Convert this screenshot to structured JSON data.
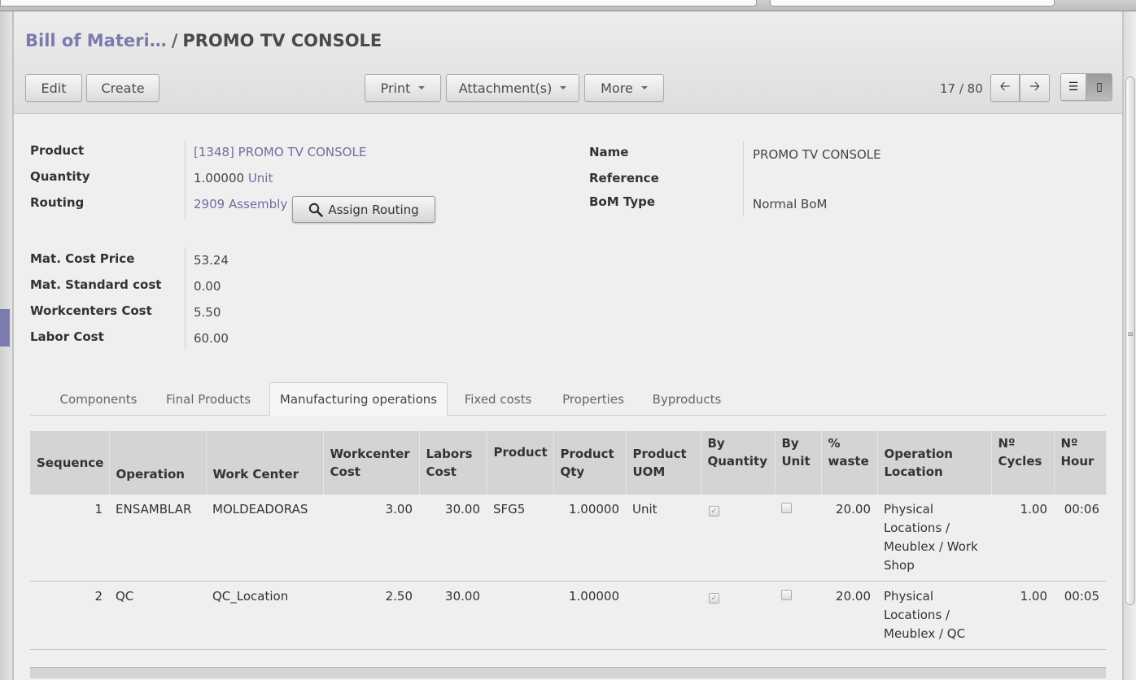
{
  "breadcrumb": {
    "parent": "Bill of Materi…",
    "separator": "/",
    "current": "PROMO TV CONSOLE"
  },
  "toolbar": {
    "edit": "Edit",
    "create": "Create",
    "print": "Print",
    "attachments": "Attachment(s)",
    "more": "More",
    "pager": "17 / 80"
  },
  "form": {
    "product_label": "Product",
    "product_value": "[1348] PROMO TV CONSOLE",
    "quantity_label": "Quantity",
    "quantity_value": "1.00000",
    "quantity_uom": "Unit",
    "routing_label": "Routing",
    "routing_value": "2909 Assembly",
    "assign_routing": "Assign Routing",
    "name_label": "Name",
    "name_value": "PROMO TV CONSOLE",
    "reference_label": "Reference",
    "reference_value": "",
    "bom_type_label": "BoM Type",
    "bom_type_value": "Normal BoM",
    "mat_cost_label": "Mat. Cost Price",
    "mat_cost_value": "53.24",
    "mat_std_label": "Mat. Standard cost",
    "mat_std_value": "0.00",
    "wc_cost_label": "Workcenters Cost",
    "wc_cost_value": "5.50",
    "labor_label": "Labor Cost",
    "labor_value": "60.00"
  },
  "tabs": [
    "Components",
    "Final Products",
    "Manufacturing operations",
    "Fixed costs",
    "Properties",
    "Byproducts"
  ],
  "active_tab": "Manufacturing operations",
  "table": {
    "columns": [
      "Sequence",
      "Operation",
      "Work Center",
      "Workcenter Cost",
      "Labors Cost",
      "Product",
      "Product Qty",
      "Product UOM",
      "By Quantity",
      "By Unit",
      "% waste",
      "Operation Location",
      "Nº Cycles",
      "Nº Hour"
    ],
    "rows": [
      {
        "sequence": "1",
        "operation": "ENSAMBLAR",
        "work_center": "MOLDEADORAS",
        "wc_cost": "3.00",
        "labors_cost": "30.00",
        "product": "SFG5",
        "qty": "1.00000",
        "uom": "Unit",
        "by_quantity": true,
        "by_unit": false,
        "waste": "20.00",
        "location": "Physical Locations / Meublex / Work Shop",
        "cycles": "1.00",
        "hour": "00:06"
      },
      {
        "sequence": "2",
        "operation": "QC",
        "work_center": "QC_Location",
        "wc_cost": "2.50",
        "labors_cost": "30.00",
        "product": "",
        "qty": "1.00000",
        "uom": "",
        "by_quantity": true,
        "by_unit": false,
        "waste": "20.00",
        "location": "Physical Locations / Meublex / QC",
        "cycles": "1.00",
        "hour": "00:05"
      }
    ]
  },
  "icons": {
    "search": "search-icon",
    "prev": "arrow-left-icon",
    "next": "arrow-right-icon",
    "list_view": "list-view-icon",
    "form_view": "form-view-icon"
  },
  "colors": {
    "link": "#7c7bad",
    "header_bg": "#d4d4d4",
    "panel_bg": "#efefef"
  }
}
